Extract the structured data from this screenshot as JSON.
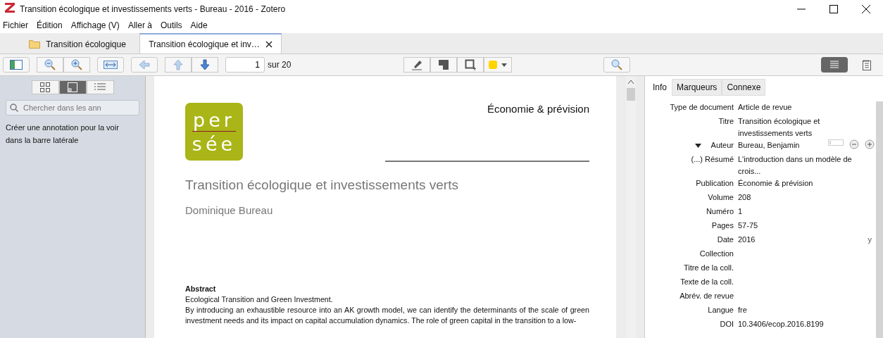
{
  "window": {
    "title": "Transition écologique et investissements verts - Bureau - 2016 - Zotero"
  },
  "menu": [
    {
      "label": "Fichier"
    },
    {
      "label": "Édition"
    },
    {
      "label": "Affichage (V)"
    },
    {
      "label": "Aller à"
    },
    {
      "label": "Outils"
    },
    {
      "label": "Aide"
    }
  ],
  "tabs": [
    {
      "label": "Transition écologique",
      "kind": "library",
      "selected": false
    },
    {
      "label": "Transition écologique et inv…",
      "kind": "reader",
      "selected": true
    }
  ],
  "toolbar": {
    "page_number": "1",
    "page_total": "sur 20"
  },
  "sidebar": {
    "view_buttons": [
      {
        "kind": "thumbnails",
        "selected": false
      },
      {
        "kind": "annotations",
        "selected": true
      },
      {
        "kind": "outline",
        "selected": false
      }
    ],
    "search": {
      "placeholder": "Chercher dans les ann"
    },
    "hint": "Créer une annotation pour la voir dans la barre latérale"
  },
  "document": {
    "logo_lines": [
      "per",
      "sée"
    ],
    "journal": "Économie & prévision",
    "title": "Transition écologique et investissements verts",
    "author": "Dominique Bureau",
    "abstract_heading": "Abstract",
    "abstract_subtitle": "Ecological Transition and Green Investment.",
    "abstract_text": "By introducing an exhaustible resource into an AK growth model, we can identify the determinants of the scale of green investment needs and its impact on capital accumulation dynamics. The role of green capital in the transition to a low-"
  },
  "pane_toggles": [
    {
      "kind": "info",
      "selected": true
    },
    {
      "kind": "notes",
      "selected": false
    }
  ],
  "info_tabs": [
    {
      "label": "Info",
      "selected": true
    },
    {
      "label": "Marqueurs",
      "selected": false
    },
    {
      "label": "Connexe",
      "selected": false
    }
  ],
  "fields": [
    {
      "label": "Type de document",
      "value": "Article de revue"
    },
    {
      "label": "Titre",
      "value": "Transition écologique et investissements verts"
    },
    {
      "label": "Auteur",
      "value": "Bureau, Benjamin",
      "kind": "creator"
    },
    {
      "label": "(...) Résumé",
      "value": "L'introduction dans un modèle de crois..."
    },
    {
      "label": "Publication",
      "value": "Économie & prévision"
    },
    {
      "label": "Volume",
      "value": "208"
    },
    {
      "label": "Numéro",
      "value": "1"
    },
    {
      "label": "Pages",
      "value": "57-75"
    },
    {
      "label": "Date",
      "value": "2016",
      "suffix": "y"
    },
    {
      "label": "Collection"
    },
    {
      "label": "Titre de la coll."
    },
    {
      "label": "Texte de la coll."
    },
    {
      "label": "Abrév. de revue"
    },
    {
      "label": "Langue",
      "value": "fre"
    },
    {
      "label": "DOI",
      "value": "10.3406/ecop.2016.8199"
    }
  ]
}
